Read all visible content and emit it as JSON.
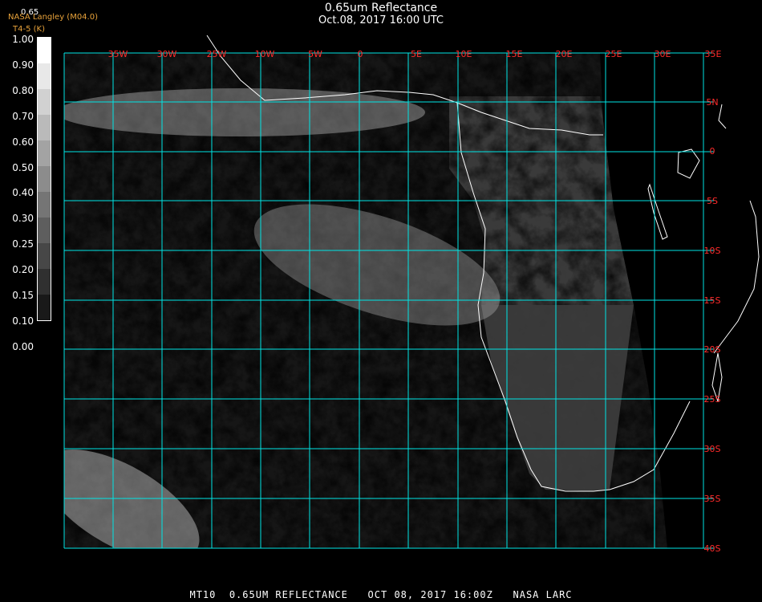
{
  "header": {
    "title": "0.65um Reflectance",
    "subtitle": "Oct.08, 2017 16:00 UTC",
    "credit_line1": "NASA Langley (M04.0)",
    "credit_line2": "T4-5 (K)",
    "colorbar_top_value": "0.65"
  },
  "colorbar": {
    "labels": [
      "1.00",
      "0.90",
      "0.80",
      "0.70",
      "0.60",
      "0.50",
      "0.40",
      "0.30",
      "0.25",
      "0.20",
      "0.15",
      "0.10",
      "0.00"
    ]
  },
  "map": {
    "grid_color": "#00e5e5",
    "label_color": "#ff2a2a",
    "coastline_color": "#ffffff",
    "lon_labels": [
      "35W",
      "30W",
      "25W",
      "10W",
      "5W",
      "0",
      "5E",
      "10E",
      "15E",
      "20E",
      "25E",
      "30E",
      "35E"
    ],
    "lat_labels": [
      "5N",
      "0",
      "5S",
      "10S",
      "15S",
      "20S",
      "25S",
      "30S",
      "35S",
      "40S"
    ]
  },
  "footer": {
    "text": "MT10  0.65UM REFLECTANCE   OCT 08, 2017 16:00Z   NASA LARC"
  }
}
